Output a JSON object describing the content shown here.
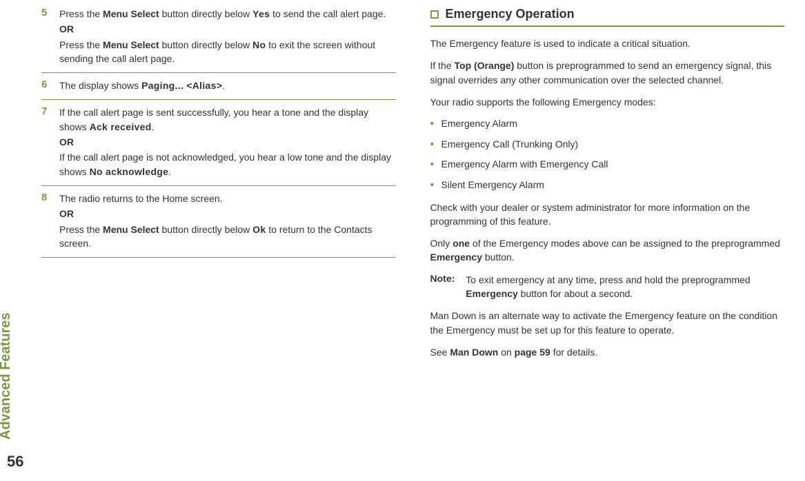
{
  "sidebar": {
    "label": "Advanced Features",
    "page_number": "56"
  },
  "left": {
    "steps": [
      {
        "num": "5",
        "line1_a": "Press the ",
        "line1_b": "Menu Select",
        "line1_c": " button directly below ",
        "line1_d": "Yes",
        "line1_e": " to send the call alert page.",
        "or": "OR",
        "line2_a": "Press the ",
        "line2_b": "Menu Select",
        "line2_c": " button directly below ",
        "line2_d": "No",
        "line2_e": " to exit the screen without sending the call alert page."
      },
      {
        "num": "6",
        "line1_a": "The display shows ",
        "line1_b": "Paging... <Alias>",
        "line1_c": "."
      },
      {
        "num": "7",
        "line1_a": "If the call alert page is sent successfully, you hear a tone and the display shows ",
        "line1_b": "Ack received",
        "line1_c": ".",
        "or": "OR",
        "line2_a": "If the call alert page is not acknowledged, you hear a low tone and the display shows ",
        "line2_b": "No acknowledge",
        "line2_c": "."
      },
      {
        "num": "8",
        "line1_a": "The radio returns to the Home screen.",
        "or": "OR",
        "line2_a": "Press the ",
        "line2_b": "Menu Select",
        "line2_c": " button directly below ",
        "line2_d": "Ok",
        "line2_e": " to return to the Contacts screen."
      }
    ]
  },
  "right": {
    "header": "Emergency Operation",
    "p1": "The Emergency feature is used to indicate a critical situation.",
    "p2_a": "If the ",
    "p2_b": "Top (Orange)",
    "p2_c": " button is preprogrammed to send an emergency signal, this signal overrides any other communication over the selected channel.",
    "p3": "Your radio supports the following Emergency modes:",
    "bullets": [
      "Emergency Alarm",
      "Emergency Call (Trunking Only)",
      "Emergency Alarm with Emergency Call",
      "Silent Emergency Alarm"
    ],
    "p4": "Check with your dealer or system administrator for more information on the programming of this feature.",
    "p5_a": "Only ",
    "p5_b": "one",
    "p5_c": " of the Emergency modes above can be assigned to the preprogrammed ",
    "p5_d": "Emergency",
    "p5_e": " button.",
    "note_label": "Note:",
    "note_a": "To exit emergency at any time, press and hold the preprogrammed ",
    "note_b": "Emergency",
    "note_c": " button for about a second.",
    "p6": "Man Down is an alternate way to activate the Emergency feature on the condition the Emergency must be set up for this feature to operate.",
    "p7_a": "See ",
    "p7_b": "Man Down",
    "p7_c": " on ",
    "p7_d": "page 59",
    "p7_e": " for details."
  }
}
